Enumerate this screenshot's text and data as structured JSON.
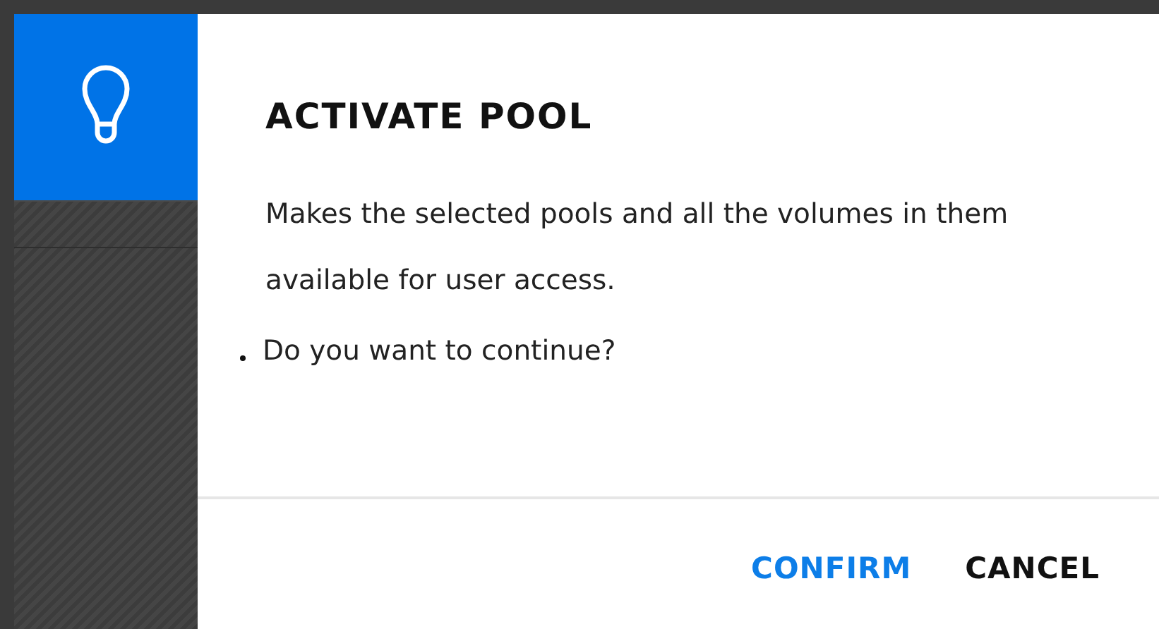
{
  "dialog": {
    "title": "ACTIVATE POOL",
    "message": "Makes the selected pools and all the volumes in them available for user access.",
    "question": "Do you want to continue?",
    "buttons": [
      {
        "label": "CONFIRM",
        "kind": "primary"
      },
      {
        "label": "CANCEL",
        "kind": "secondary"
      }
    ]
  }
}
